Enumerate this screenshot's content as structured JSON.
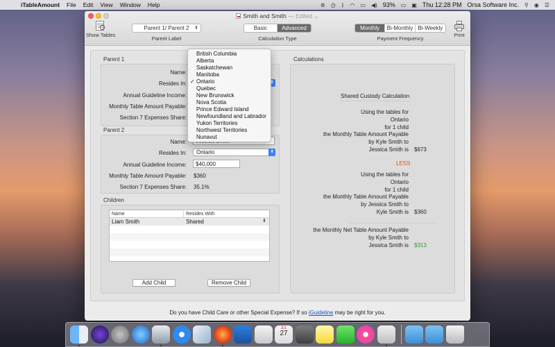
{
  "menubar": {
    "app_name": "iTableAmount",
    "items": [
      "File",
      "Edit",
      "View",
      "Window",
      "Help"
    ],
    "battery": "93%",
    "clock": "Thu 12:28 PM",
    "user": "Orsa Software Inc."
  },
  "window": {
    "title": "Smith and Smith",
    "edited": "— Edited ⌄"
  },
  "toolbar": {
    "show_tables_label": "Show Tables",
    "parent_label_value": "Parent 1/ Parent 2",
    "parent_label_caption": "Parent Label",
    "calc_type_options": [
      "Basic",
      "Advanced"
    ],
    "calc_type_selected": "Advanced",
    "calc_type_caption": "Calculation Type",
    "freq_options": [
      "Monthly",
      "Bi-Monthly",
      "Bi-Weekly"
    ],
    "freq_selected": "Monthly",
    "freq_caption": "Payment Frequency",
    "print_label": "Print"
  },
  "parent1": {
    "group_title": "Parent 1",
    "name_label": "Name:",
    "resides_label": "Resides In:",
    "income_label": "Annual Guideline Income:",
    "table_amount_label": "Monthly Table Amount Payable:",
    "section7_label": "Section 7 Expenses Share:"
  },
  "parent2": {
    "group_title": "Parent 2",
    "name_label": "Name:",
    "name_value": "Jessica Smith",
    "resides_label": "Resides In:",
    "resides_value": "Ontario",
    "income_label": "Annual Guideline Income:",
    "income_value": "$40,000",
    "table_amount_label": "Monthly Table Amount Payable:",
    "table_amount_value": "$360",
    "section7_label": "Section 7 Expenses Share:",
    "section7_value": "35.1%"
  },
  "province_dropdown": {
    "options": [
      "British Columbia",
      "Alberta",
      "Saskatchewan",
      "Manitoba",
      "Ontario",
      "Quebec",
      "New Brunswick",
      "Nova Scotia",
      "Prince Edward Island",
      "Newfoundland and Labrador",
      "Yukon Territories",
      "Northwest Territories",
      "Nunavut"
    ],
    "selected": "Ontario",
    "check": "✓"
  },
  "children": {
    "group_title": "Children",
    "columns": [
      "Name",
      "Resides With"
    ],
    "rows": [
      {
        "name": "Liam Smith",
        "resides_with": "Shared"
      }
    ],
    "add_button": "Add Child",
    "remove_button": "Remove Child"
  },
  "calculations": {
    "group_title": "Calculations",
    "heading": "Shared Custody Calculation",
    "block1": [
      "Using the tables for",
      "Ontario",
      "for 1 child",
      "the Monthly Table Amount Payable",
      "by Kyle Smith to",
      "Jessica Smith is"
    ],
    "block1_amount": "$673",
    "less_label": "LESS",
    "block2": [
      "Using the tables for",
      "Ontario",
      "for 1 child",
      "the Monthly Table Amount Payable",
      "by Jessica Smith to",
      "Kyle Smith is"
    ],
    "block2_amount": "$360",
    "net": [
      "the Monthly Net Table Amount Payable",
      "by Kyle Smith to",
      "Jessica Smith is"
    ],
    "net_amount": "$313"
  },
  "footer": {
    "note_before": "Do you have Child Care or other Special Expense? If so",
    "link": "iGuideline",
    "note_after": "may be right for you."
  },
  "colors": {
    "less": "#e0531f",
    "net_amount": "#2aa02a",
    "link": "#1a55c7"
  },
  "dock": {
    "calendar_month": "JUL",
    "calendar_day": "27"
  }
}
